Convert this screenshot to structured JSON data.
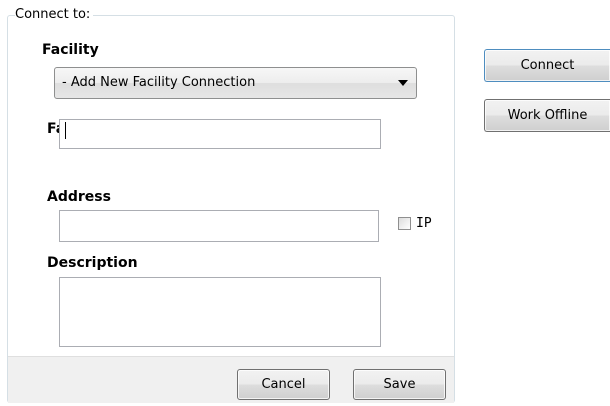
{
  "group": {
    "title": "Connect to:"
  },
  "connect_to": {
    "label": "Facility",
    "selected": "- Add New Facility Connection"
  },
  "form": {
    "facility_label": "Facility",
    "facility_value": "",
    "address_label": "Address",
    "address_value": "",
    "ip_label": "IP",
    "ip_checked": false,
    "description_label": "Description",
    "description_value": ""
  },
  "footer": {
    "cancel_label": "Cancel",
    "save_label": "Save"
  },
  "side_buttons": {
    "connect_label": "Connect",
    "work_offline_label": "Work Offline"
  },
  "colors": {
    "frame_border": "#d5dfe5",
    "footer_bg": "#f0f0f0",
    "default_button_border": "#4e8dbf"
  },
  "icons": {
    "combo_arrow": "chevron-down-icon"
  }
}
